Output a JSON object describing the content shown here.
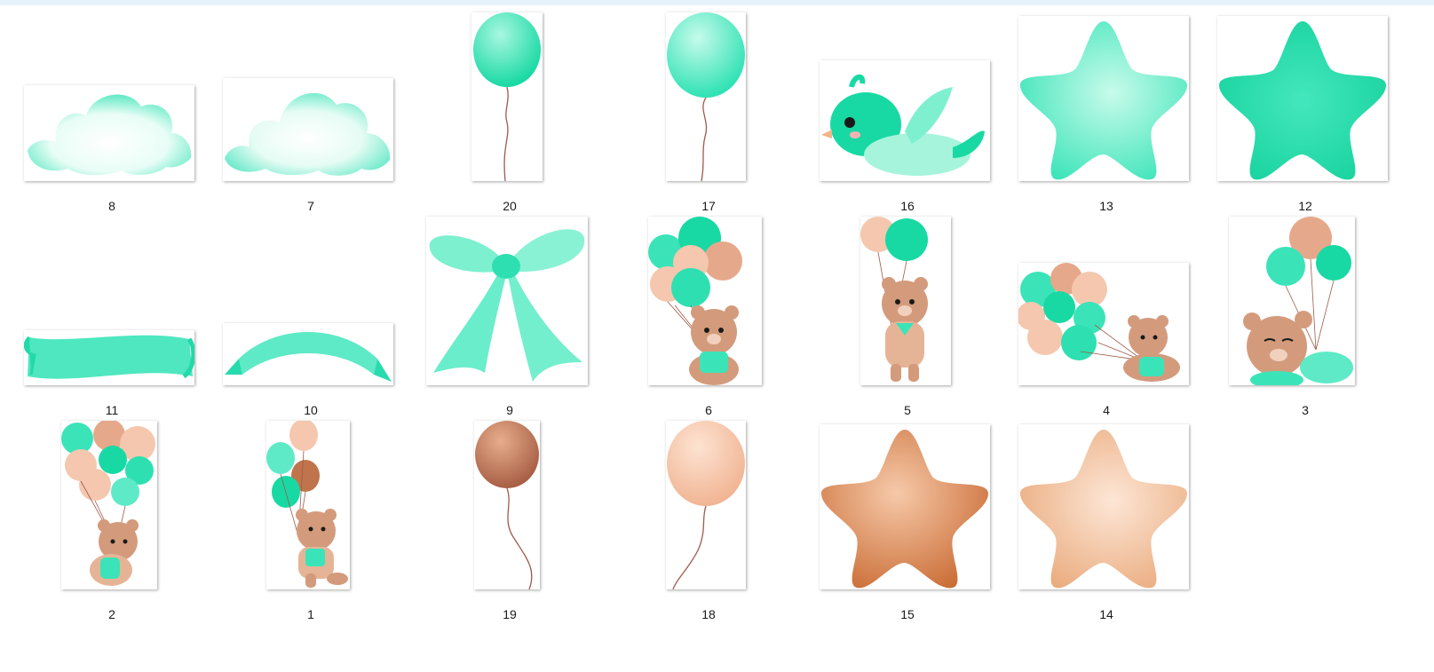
{
  "window": {
    "accent_color": "#e6f1fa"
  },
  "colors": {
    "mint": "#20e3b0",
    "mint_light": "#c8fbeb",
    "peach": "#f4c7ae",
    "brown": "#c0744c",
    "bear": "#d39b7c",
    "string": "#9e5a4a"
  },
  "files": [
    {
      "label": "8",
      "icon": "cloud-icon"
    },
    {
      "label": "7",
      "icon": "cloud-icon"
    },
    {
      "label": "20",
      "icon": "balloon-icon"
    },
    {
      "label": "17",
      "icon": "balloon-icon"
    },
    {
      "label": "16",
      "icon": "bird-icon"
    },
    {
      "label": "13",
      "icon": "star-icon"
    },
    {
      "label": "12",
      "icon": "star-icon"
    },
    {
      "label": "11",
      "icon": "ribbon-banner-icon"
    },
    {
      "label": "10",
      "icon": "ribbon-banner-icon"
    },
    {
      "label": "9",
      "icon": "bow-icon"
    },
    {
      "label": "6",
      "icon": "bear-with-balloons-icon"
    },
    {
      "label": "5",
      "icon": "bear-with-balloons-icon"
    },
    {
      "label": "4",
      "icon": "bear-with-balloons-icon"
    },
    {
      "label": "3",
      "icon": "bear-with-balloons-icon"
    },
    {
      "label": "2",
      "icon": "bear-with-balloons-icon"
    },
    {
      "label": "1",
      "icon": "bear-with-balloons-icon"
    },
    {
      "label": "19",
      "icon": "balloon-icon"
    },
    {
      "label": "18",
      "icon": "balloon-icon"
    },
    {
      "label": "15",
      "icon": "star-icon"
    },
    {
      "label": "14",
      "icon": "star-icon"
    }
  ]
}
